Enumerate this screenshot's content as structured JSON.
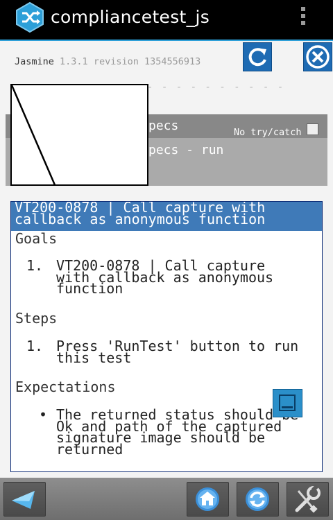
{
  "app": {
    "title": "compliancetest_js",
    "accent_color": "#2d9fd8",
    "icon": "shuffle-app-icon"
  },
  "jasmine": {
    "name": "Jasmine",
    "version": "1.3.1 revision 1354556913"
  },
  "buttons": {
    "refresh_icon": "refresh-icon",
    "close_icon": "close-icon"
  },
  "dashes": "- - - - - - - - - -",
  "specs": {
    "header_partial": "pecs",
    "no_try_catch": "No try/catch",
    "run_partial": "pecs - run"
  },
  "panel": {
    "title": "VT200-0878 | Call capture with callback as anonymous function",
    "goals_heading": "Goals",
    "goals": [
      {
        "num": "1.",
        "lines": [
          "VT200-0878 | Call capture",
          "with callback as anonymous",
          "function"
        ]
      }
    ],
    "steps_heading": "Steps",
    "steps": [
      {
        "num": "1.",
        "lines": [
          "Press 'RunTest' button to run",
          "this test"
        ]
      }
    ],
    "expectations_heading": "Expectations",
    "expectations": [
      {
        "bullet": "•",
        "lines": [
          "The returned status should be",
          "Ok and path of the captured",
          "signature image should be",
          "returned"
        ]
      }
    ]
  },
  "toolbar": {
    "back_icon": "back-arrow-icon",
    "home_icon": "home-icon",
    "sync_icon": "sync-icon",
    "settings_icon": "settings-wrench-icon"
  }
}
